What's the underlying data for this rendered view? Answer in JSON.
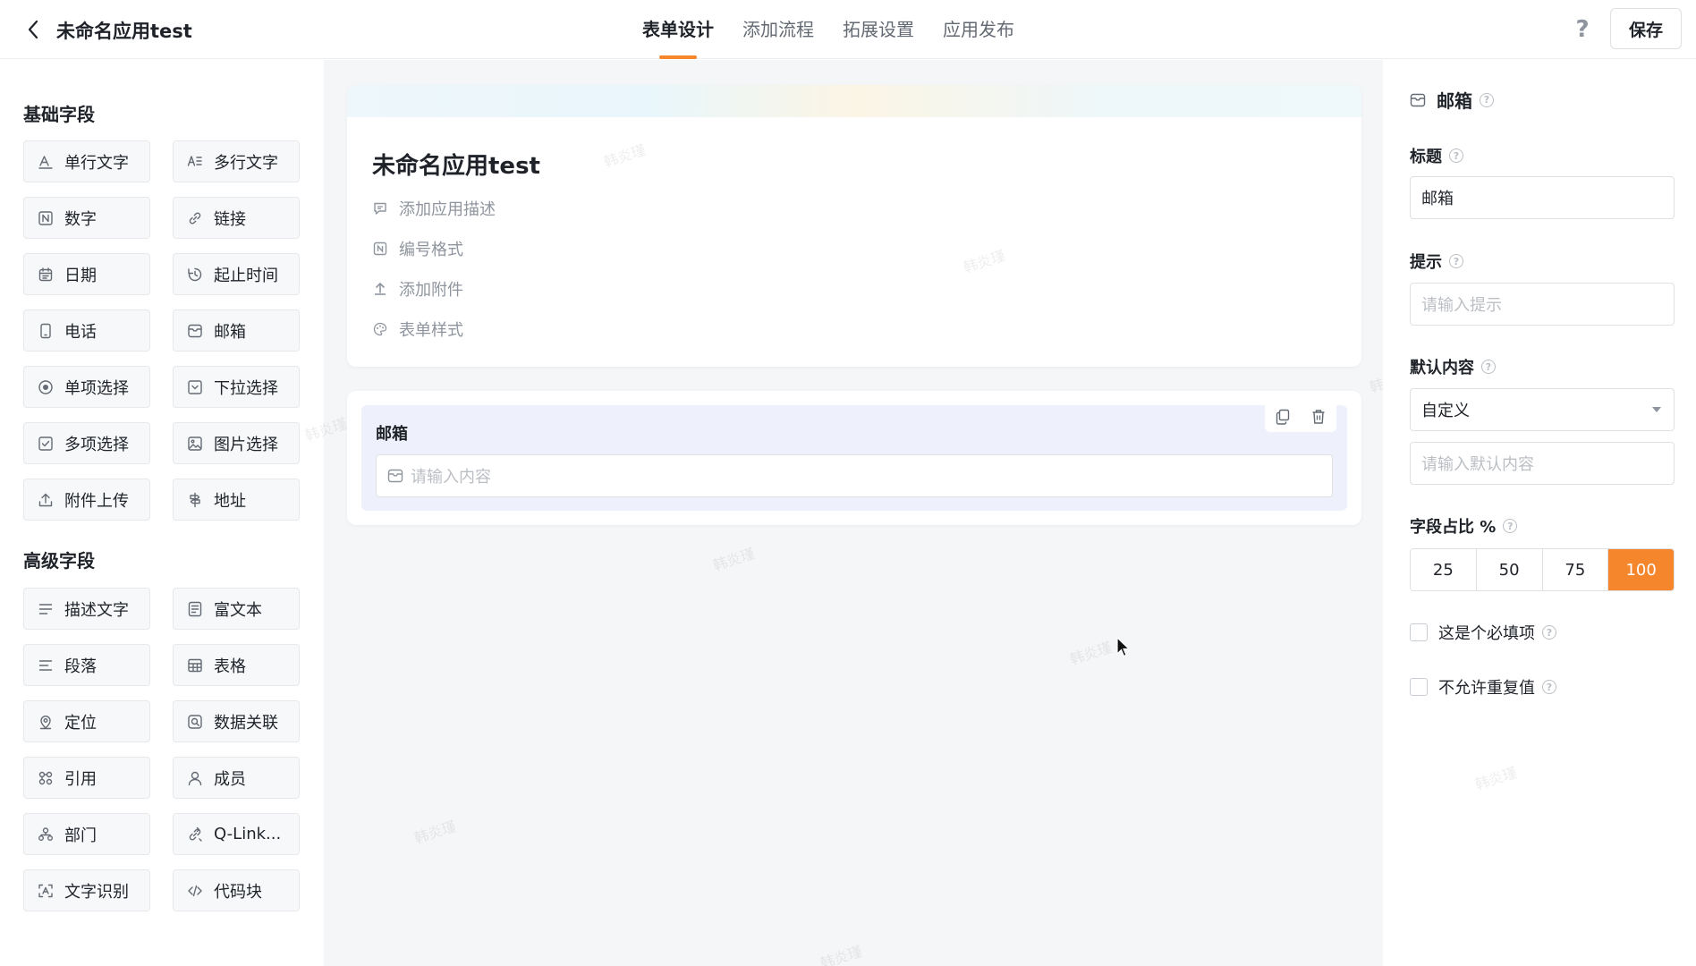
{
  "header": {
    "app_title": "未命名应用test",
    "tabs": [
      {
        "label": "表单设计",
        "active": true
      },
      {
        "label": "添加流程",
        "active": false
      },
      {
        "label": "拓展设置",
        "active": false
      },
      {
        "label": "应用发布",
        "active": false
      }
    ],
    "help_label": "?",
    "save_label": "保存"
  },
  "palette": {
    "basic_title": "基础字段",
    "basic_fields": [
      {
        "label": "单行文字",
        "icon": "text-single-icon"
      },
      {
        "label": "多行文字",
        "icon": "text-multi-icon"
      },
      {
        "label": "数字",
        "icon": "number-icon"
      },
      {
        "label": "链接",
        "icon": "link-icon"
      },
      {
        "label": "日期",
        "icon": "calendar-icon"
      },
      {
        "label": "起止时间",
        "icon": "clock-range-icon"
      },
      {
        "label": "电话",
        "icon": "phone-icon"
      },
      {
        "label": "邮箱",
        "icon": "mail-icon"
      },
      {
        "label": "单项选择",
        "icon": "radio-icon"
      },
      {
        "label": "下拉选择",
        "icon": "dropdown-icon"
      },
      {
        "label": "多项选择",
        "icon": "checkbox-icon"
      },
      {
        "label": "图片选择",
        "icon": "image-icon"
      },
      {
        "label": "附件上传",
        "icon": "upload-icon"
      },
      {
        "label": "地址",
        "icon": "signpost-icon"
      }
    ],
    "advanced_title": "高级字段",
    "advanced_fields": [
      {
        "label": "描述文字",
        "icon": "description-icon"
      },
      {
        "label": "富文本",
        "icon": "richtext-icon"
      },
      {
        "label": "段落",
        "icon": "paragraph-icon"
      },
      {
        "label": "表格",
        "icon": "table-icon"
      },
      {
        "label": "定位",
        "icon": "location-icon"
      },
      {
        "label": "数据关联",
        "icon": "data-link-icon"
      },
      {
        "label": "引用",
        "icon": "reference-icon"
      },
      {
        "label": "成员",
        "icon": "member-icon"
      },
      {
        "label": "部门",
        "icon": "department-icon"
      },
      {
        "label": "Q-Link...",
        "icon": "qlink-icon"
      },
      {
        "label": "文字识别",
        "icon": "ocr-icon"
      },
      {
        "label": "代码块",
        "icon": "code-icon"
      }
    ]
  },
  "canvas": {
    "form_title": "未命名应用test",
    "meta": [
      {
        "label": "添加应用描述",
        "icon": "comment-icon"
      },
      {
        "label": "编号格式",
        "icon": "number-format-icon"
      },
      {
        "label": "添加附件",
        "icon": "attachment-upload-icon"
      },
      {
        "label": "表单样式",
        "icon": "palette-icon"
      }
    ],
    "field": {
      "label": "邮箱",
      "placeholder": "请输入内容"
    },
    "watermark": "韩炎瑾"
  },
  "props": {
    "field_type": "邮箱",
    "title_label": "标题",
    "title_value": "邮箱",
    "hint_label": "提示",
    "hint_placeholder": "请输入提示",
    "default_label": "默认内容",
    "default_mode": "自定义",
    "default_placeholder": "请输入默认内容",
    "width_label": "字段占比 %",
    "width_options": [
      "25",
      "50",
      "75",
      "100"
    ],
    "width_selected": "100",
    "required_label": "这是个必填项",
    "unique_label": "不允许重复值",
    "accent": "#f5862b"
  }
}
